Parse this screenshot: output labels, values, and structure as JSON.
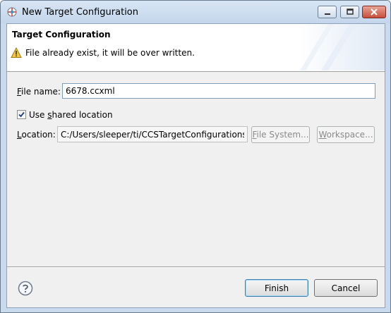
{
  "window": {
    "title": "New Target Configuration"
  },
  "banner": {
    "title": "Target Configuration",
    "message": "File already exist, it will be over written."
  },
  "form": {
    "file_name_label_pre": "",
    "file_name_label_mnemonic": "F",
    "file_name_label_post": "ile name:",
    "file_name_value": "6678.ccxml",
    "use_shared_location_pre": "Use ",
    "use_shared_location_mnemonic": "s",
    "use_shared_location_post": "hared location",
    "use_shared_location_checked": true,
    "location_label_pre": "",
    "location_label_mnemonic": "L",
    "location_label_post": "ocation:",
    "location_value": "C:/Users/sleeper/ti/CCSTargetConfigurations",
    "file_system_pre": "",
    "file_system_mnemonic": "F",
    "file_system_post": "ile System...",
    "workspace_pre": "",
    "workspace_mnemonic": "W",
    "workspace_post": "orkspace..."
  },
  "footer": {
    "finish_label": "Finish",
    "cancel_label": "Cancel"
  },
  "colors": {
    "titlebar": "#c4d6ec",
    "dialog_bg": "#f0f0f0",
    "default_button_border": "#3c7fb1"
  },
  "icons": {
    "app": "target-config-icon",
    "warning": "warning-icon",
    "help": "help-icon"
  }
}
